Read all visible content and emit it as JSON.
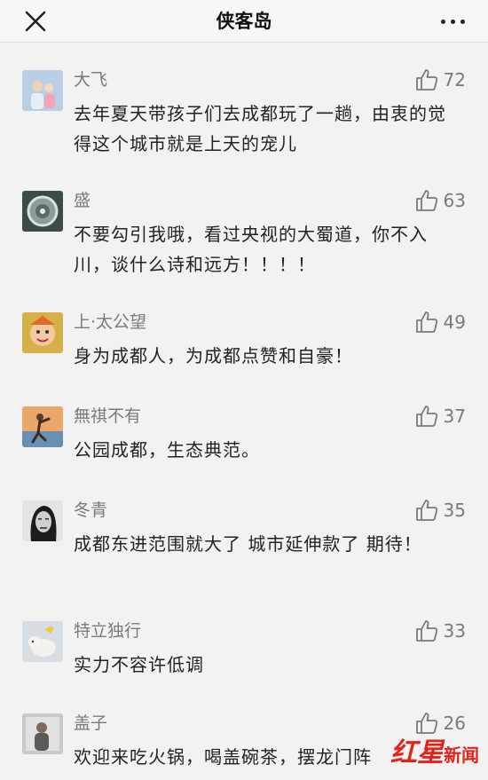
{
  "header": {
    "title": "侠客岛"
  },
  "comments": [
    {
      "username": "大飞",
      "likes": "72",
      "text": "去年夏天带孩子们去成都玩了一趟，由衷的觉得这个城市就是上天的宠儿"
    },
    {
      "username": "盛",
      "likes": "63",
      "text": "不要勾引我哦，看过央视的大蜀道，你不入川，谈什么诗和远方！！！！"
    },
    {
      "username": "上·太公望",
      "likes": "49",
      "text": "身为成都人，为成都点赞和自豪！"
    },
    {
      "username": "無祺不有",
      "likes": "37",
      "text": "公园成都，生态典范。"
    },
    {
      "username": "冬青",
      "likes": "35",
      "text": "成都东进范围就大了 城市延伸款了 期待！"
    },
    {
      "username": "特立独行",
      "likes": "33",
      "text": "实力不容许低调"
    },
    {
      "username": "盖子",
      "likes": "26",
      "text": "欢迎来吃火锅，喝盖碗茶，摆龙门阵"
    }
  ],
  "watermark": {
    "part1": "红星",
    "part2": "新闻"
  },
  "colors": {
    "accent": "#e2231a",
    "meta_text": "#7a7a7a",
    "body_text": "#222222"
  },
  "icons": [
    "close-icon",
    "more-icon",
    "thumbs-up-icon"
  ]
}
